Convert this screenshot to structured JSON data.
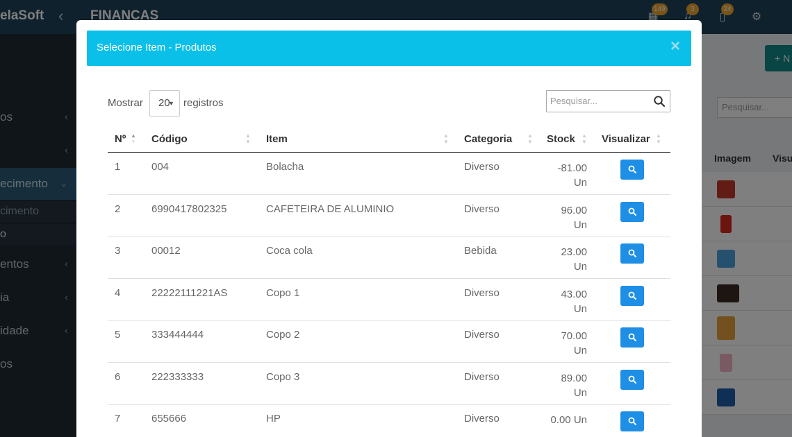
{
  "app": {
    "brand": "elaSoft",
    "module_title": "FINANCAS",
    "badges": {
      "calendar": "149",
      "notifications": "3",
      "documents": "24"
    }
  },
  "sidebar": {
    "items": [
      {
        "label": "os"
      },
      {
        "label": ""
      },
      {
        "label": "ecimento"
      },
      {
        "label": "entos"
      },
      {
        "label": "ia"
      },
      {
        "label": "idade"
      },
      {
        "label": "os"
      }
    ],
    "subitems": [
      {
        "label": "cimento"
      },
      {
        "label": "o"
      }
    ]
  },
  "background": {
    "add_button": "+ N",
    "search_placeholder": "Pesquisar...",
    "columns": [
      "Imagem",
      "Visu"
    ]
  },
  "modal": {
    "title": "Selecione Item - Produtos",
    "close": "×",
    "length": {
      "prefix": "Mostrar",
      "value": "20",
      "suffix": "registros"
    },
    "search_placeholder": "Pesquisar...",
    "columns": [
      "Nº",
      "Código",
      "Item",
      "Categoria",
      "Stock",
      "Visualizar"
    ],
    "rows": [
      {
        "n": "1",
        "codigo": "004",
        "item": "Bolacha",
        "categoria": "Diverso",
        "stock_value": "-81.00",
        "stock_unit": "Un"
      },
      {
        "n": "2",
        "codigo": "6990417802325",
        "item": "CAFETEIRA DE ALUMINIO",
        "categoria": "Diverso",
        "stock_value": "96.00",
        "stock_unit": "Un"
      },
      {
        "n": "3",
        "codigo": "00012",
        "item": "Coca cola",
        "categoria": "Bebida",
        "stock_value": "23.00",
        "stock_unit": "Un"
      },
      {
        "n": "4",
        "codigo": "22222111221AS",
        "item": "Copo 1",
        "categoria": "Diverso",
        "stock_value": "43.00",
        "stock_unit": "Un"
      },
      {
        "n": "5",
        "codigo": "333444444",
        "item": "Copo 2",
        "categoria": "Diverso",
        "stock_value": "70.00",
        "stock_unit": "Un"
      },
      {
        "n": "6",
        "codigo": "222333333",
        "item": "Copo 3",
        "categoria": "Diverso",
        "stock_value": "89.00",
        "stock_unit": "Un"
      },
      {
        "n": "7",
        "codigo": "655666",
        "item": "HP",
        "categoria": "Diverso",
        "stock_value": "0.00 Un",
        "stock_unit": ""
      }
    ]
  }
}
